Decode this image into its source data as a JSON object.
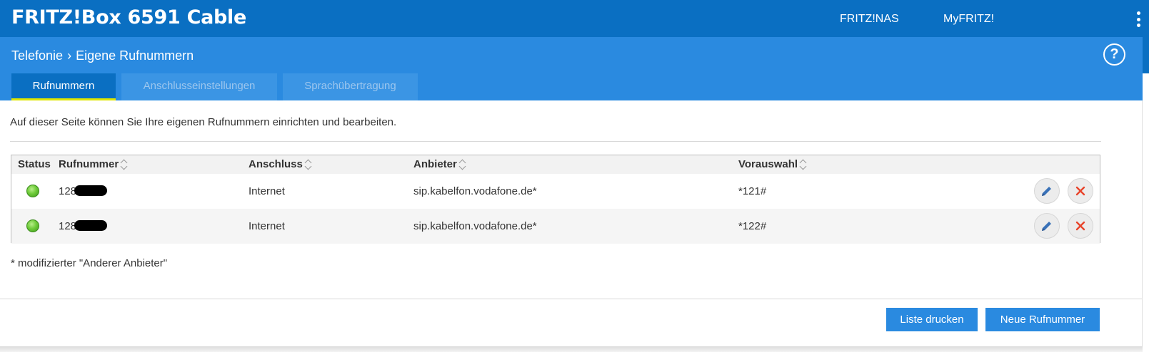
{
  "header": {
    "brand": "FRITZ!Box 6591 Cable",
    "links": [
      "FRITZ!NAS",
      "MyFRITZ!"
    ]
  },
  "breadcrumb": {
    "section": "Telefonie",
    "page": "Eigene Rufnummern"
  },
  "tabs": [
    {
      "label": "Rufnummern",
      "active": true
    },
    {
      "label": "Anschlusseinstellungen",
      "active": false
    },
    {
      "label": "Sprachübertragung",
      "active": false
    }
  ],
  "intro": "Auf dieser Seite können Sie Ihre eigenen Rufnummern einrichten und bearbeiten.",
  "table": {
    "columns": [
      "Status",
      "Rufnummer",
      "Anschluss",
      "Anbieter",
      "Vorauswahl"
    ],
    "rows": [
      {
        "number_prefix": "128",
        "anschluss": "Internet",
        "anbieter": "sip.kabelfon.vodafone.de*",
        "vorauswahl": "*121#"
      },
      {
        "number_prefix": "128",
        "anschluss": "Internet",
        "anbieter": "sip.kabelfon.vodafone.de*",
        "vorauswahl": "*122#"
      }
    ]
  },
  "footnote": "* modifizierter \"Anderer Anbieter\"",
  "buttons": {
    "print": "Liste drucken",
    "new": "Neue Rufnummer"
  },
  "colors": {
    "header": "#0a6fc2",
    "subheader": "#2a8ae0",
    "tab_underline": "#dfe600",
    "status_ok": "#6fcb3a",
    "delete": "#e8452c",
    "edit": "#3a72b8"
  },
  "icons": {
    "help": "help-icon",
    "edit": "pencil-icon",
    "delete": "close-icon",
    "menu": "kebab-menu-icon"
  }
}
